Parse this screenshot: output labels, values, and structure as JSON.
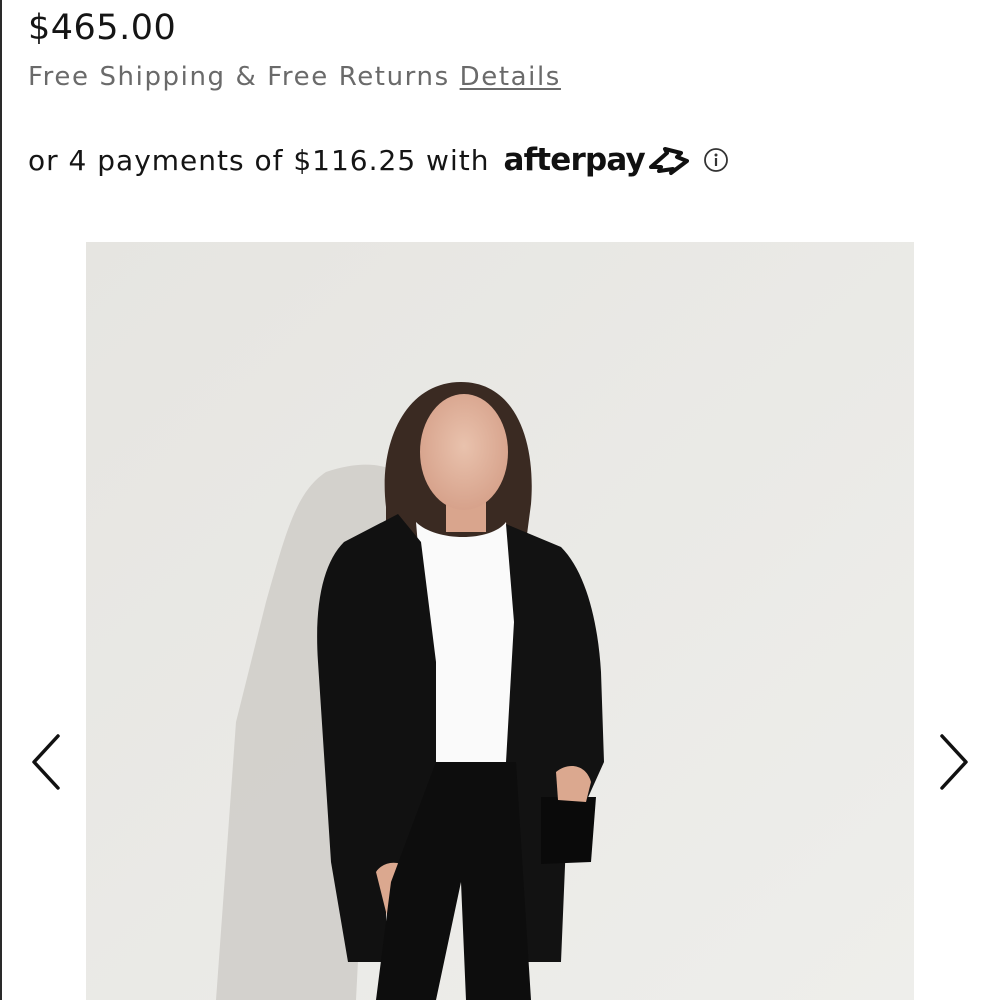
{
  "product": {
    "price": "$465.00",
    "shipping_text": "Free Shipping & Free Returns",
    "details_link": "Details"
  },
  "afterpay": {
    "message": "or 4 payments of $116.25 with",
    "logo_text": "afterpay",
    "logo_icon": "afterpay-arrows-icon",
    "info_icon": "info-circle-icon"
  },
  "gallery": {
    "prev_icon": "chevron-left-icon",
    "next_icon": "chevron-right-icon"
  }
}
